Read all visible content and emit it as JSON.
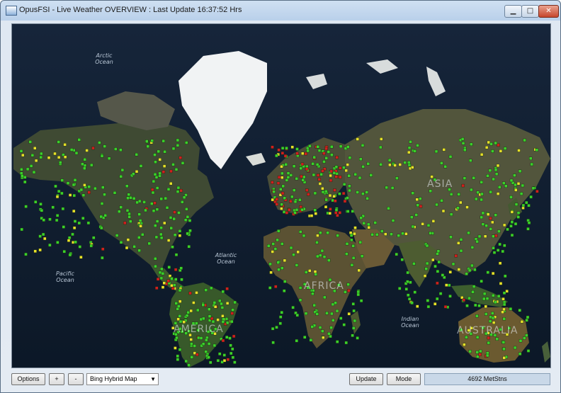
{
  "window": {
    "title": "OpusFSI - Live Weather OVERVIEW : Last Update 16:37:52 Hrs",
    "controls": {
      "minimize": "▁",
      "maximize": "□",
      "close": "✕"
    },
    "icon": "app-window-icon"
  },
  "map": {
    "ocean_labels": [
      {
        "id": "arctic",
        "text": "Arctic\nOcean"
      },
      {
        "id": "atlantic",
        "text": "Atlantic\nOcean"
      },
      {
        "id": "pacific",
        "text": "Pacific\nOcean"
      },
      {
        "id": "indian",
        "text": "Indian\nOcean"
      }
    ],
    "continent_labels": [
      {
        "id": "asia",
        "text": "ASIA"
      },
      {
        "id": "africa",
        "text": "AFRICA"
      },
      {
        "id": "america",
        "text": "AMERICA"
      },
      {
        "id": "australia",
        "text": "AUSTRALIA"
      }
    ],
    "station_colors": {
      "green": "#3ad12a",
      "yellow": "#e6e02a",
      "red": "#d11e1e"
    }
  },
  "toolbar": {
    "options_label": "Options",
    "zoom_in_label": "+",
    "zoom_out_label": "-",
    "map_type_value": "Bing Hybrid Map",
    "update_label": "Update",
    "mode_label": "Mode",
    "station_count": "4692 MetStns"
  }
}
